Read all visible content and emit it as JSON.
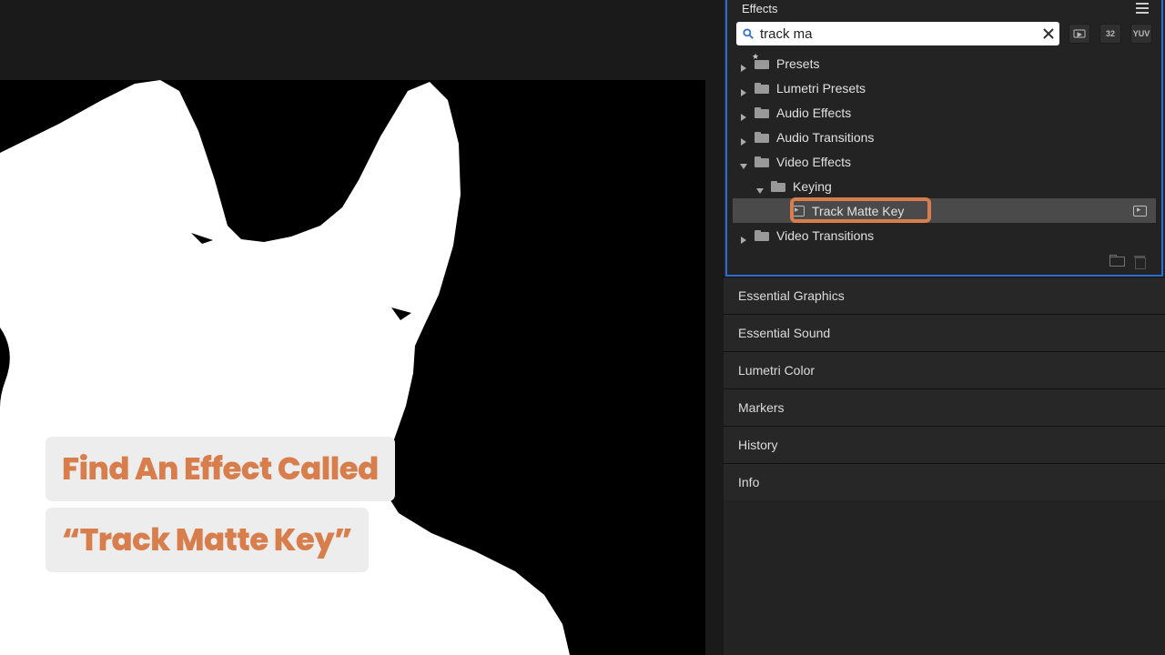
{
  "viewer": {
    "caption_line1": "Find An Effect Called",
    "caption_line2": "“Track Matte Key”"
  },
  "effects_panel": {
    "title": "Effects",
    "search_value": "track ma",
    "toggle_32": "32",
    "toggle_yuv": "YUV",
    "tree": {
      "presets": "Presets",
      "lumetri_presets": "Lumetri Presets",
      "audio_effects": "Audio Effects",
      "audio_transitions": "Audio Transitions",
      "video_effects": "Video Effects",
      "keying": "Keying",
      "track_matte_key": "Track Matte Key",
      "video_transitions": "Video Transitions"
    }
  },
  "sub_panels": [
    "Essential Graphics",
    "Essential Sound",
    "Lumetri Color",
    "Markers",
    "History",
    "Info"
  ]
}
